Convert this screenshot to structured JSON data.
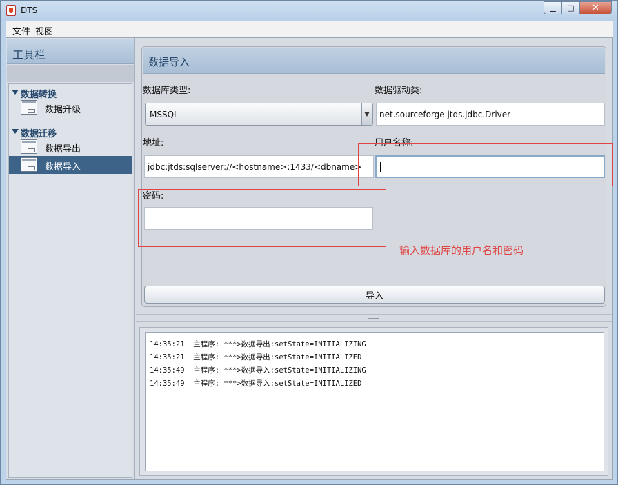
{
  "window": {
    "title": "DTS",
    "minimize_glyph": "▁",
    "maximize_glyph": "□",
    "close_glyph": "✕"
  },
  "menu": [
    {
      "label": "文件"
    },
    {
      "label": "视图"
    }
  ],
  "sidebar": {
    "title": "工具栏",
    "groups": [
      {
        "label": "数据转换",
        "items": [
          {
            "label": "数据升级",
            "selected": false
          }
        ]
      },
      {
        "label": "数据迁移",
        "items": [
          {
            "label": "数据导出",
            "selected": false
          },
          {
            "label": "数据导入",
            "selected": true
          }
        ]
      }
    ]
  },
  "main": {
    "title": "数据导入",
    "db_type_label": "数据库类型:",
    "db_type_value": "MSSQL",
    "driver_label": "数据驱动类:",
    "driver_value": "net.sourceforge.jtds.jdbc.Driver",
    "address_label": "地址:",
    "address_value": "jdbc:jtds:sqlserver://<hostname>:1433/<dbname>",
    "username_label": "用户名称:",
    "username_value": "",
    "password_label": "密码:",
    "password_value": "",
    "import_button": "导入"
  },
  "annotation": {
    "note": "输入数据库的用户名和密码",
    "color": "#e04545"
  },
  "log": [
    {
      "time": "14:35:21",
      "source": "主程序:",
      "message": "***>数据导出:setState=INITIALIZING"
    },
    {
      "time": "14:35:21",
      "source": "主程序:",
      "message": "***>数据导出:setState=INITIALIZED"
    },
    {
      "time": "14:35:49",
      "source": "主程序:",
      "message": "***>数据导入:setState=INITIALIZING"
    },
    {
      "time": "14:35:49",
      "source": "主程序:",
      "message": "***>数据导入:setState=INITIALIZED"
    }
  ],
  "colors": {
    "accent": "#24476b",
    "selection": "#3d6488",
    "highlight": "#e04545"
  }
}
